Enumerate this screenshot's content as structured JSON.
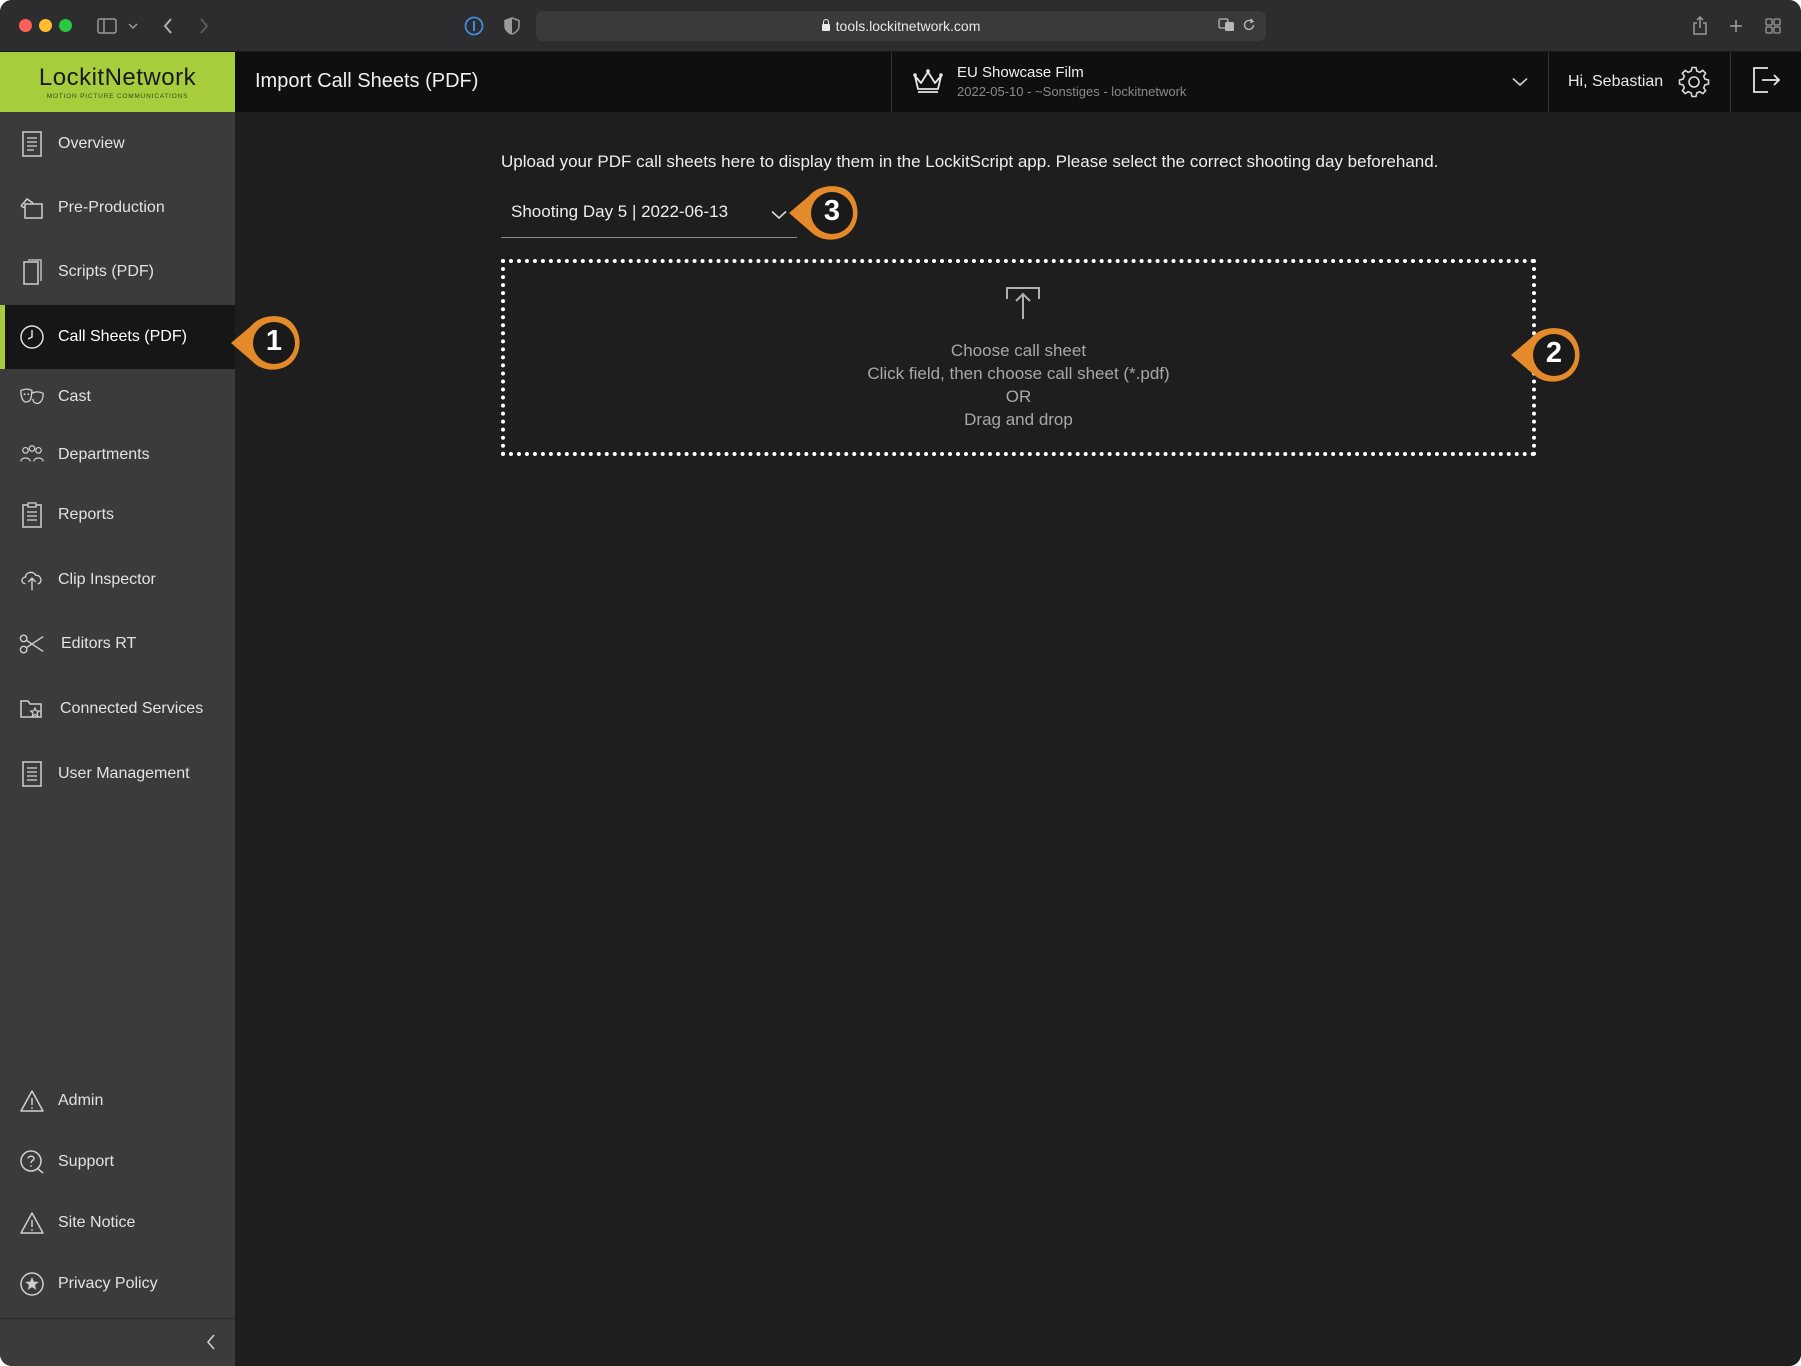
{
  "browser": {
    "url": "tools.lockitnetwork.com"
  },
  "header": {
    "logo_name": "LockitNetwork",
    "logo_tagline": "MOTION PICTURE COMMUNICATIONS",
    "page_title": "Import Call Sheets (PDF)",
    "project_name": "EU Showcase Film",
    "project_sub": "2022-05-10 - ~Sonstiges - lockitnetwork",
    "greeting": "Hi, Sebastian"
  },
  "sidebar": {
    "items": [
      {
        "label": "Overview",
        "icon": "document-icon"
      },
      {
        "label": "Pre-Production",
        "icon": "pre-production-icon"
      },
      {
        "label": "Scripts (PDF)",
        "icon": "script-icon"
      },
      {
        "label": "Call Sheets (PDF)",
        "icon": "clock-icon",
        "active": true
      },
      {
        "label": "Cast",
        "icon": "masks-icon"
      },
      {
        "label": "Departments",
        "icon": "people-icon"
      },
      {
        "label": "Reports",
        "icon": "clipboard-icon"
      },
      {
        "label": "Clip Inspector",
        "icon": "cloud-upload-icon"
      },
      {
        "label": "Editors RT",
        "icon": "scissors-icon"
      },
      {
        "label": "Connected Services",
        "icon": "folder-star-icon"
      },
      {
        "label": "User Management",
        "icon": "list-document-icon"
      }
    ],
    "bottom_items": [
      {
        "label": "Admin",
        "icon": "warning-icon"
      },
      {
        "label": "Support",
        "icon": "support-chat-icon"
      },
      {
        "label": "Site Notice",
        "icon": "warning-icon"
      },
      {
        "label": "Privacy Policy",
        "icon": "star-badge-icon"
      }
    ]
  },
  "main": {
    "intro_text": "Upload your PDF call sheets here to display them in the LockitScript app. Please select the correct shooting day beforehand.",
    "shooting_day": "Shooting Day 5 | 2022-06-13",
    "dropzone": {
      "title": "Choose call sheet",
      "line1": "Click field, then choose call sheet (*.pdf)",
      "line2": "OR",
      "line3": "Drag and drop"
    }
  },
  "callouts": {
    "c1": "1",
    "c2": "2",
    "c3": "3"
  },
  "colors": {
    "accent_green": "#a6cd3c",
    "callout_orange": "#e48a2a",
    "sidebar_bg": "#3b3b3b",
    "main_bg": "#1e1e1e"
  }
}
